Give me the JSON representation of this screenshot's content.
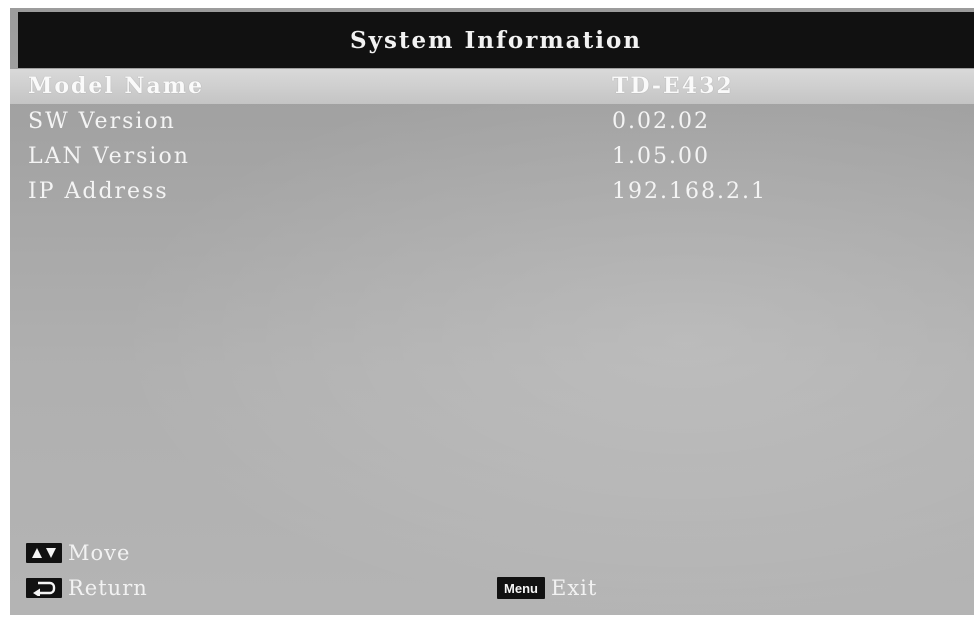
{
  "title": "System Information",
  "rows": [
    {
      "label": "Model Name",
      "value": "TD-E432",
      "selected": true
    },
    {
      "label": "SW Version",
      "value": "0.02.02",
      "selected": false
    },
    {
      "label": "LAN Version",
      "value": "1.05.00",
      "selected": false
    },
    {
      "label": "IP Address",
      "value": "192.168.2.1",
      "selected": false
    }
  ],
  "hints": {
    "move_label": "Move",
    "move_icon": "up-down-arrows-icon",
    "return_label": "Return",
    "return_icon": "return-arrow-icon",
    "exit_label": "Exit",
    "menu_key_label": "Menu"
  },
  "colors": {
    "title_bar": "#111111",
    "panel": "#a8a8a8",
    "selected_row": "#d0d0d0",
    "text": "#f4f4f4"
  }
}
